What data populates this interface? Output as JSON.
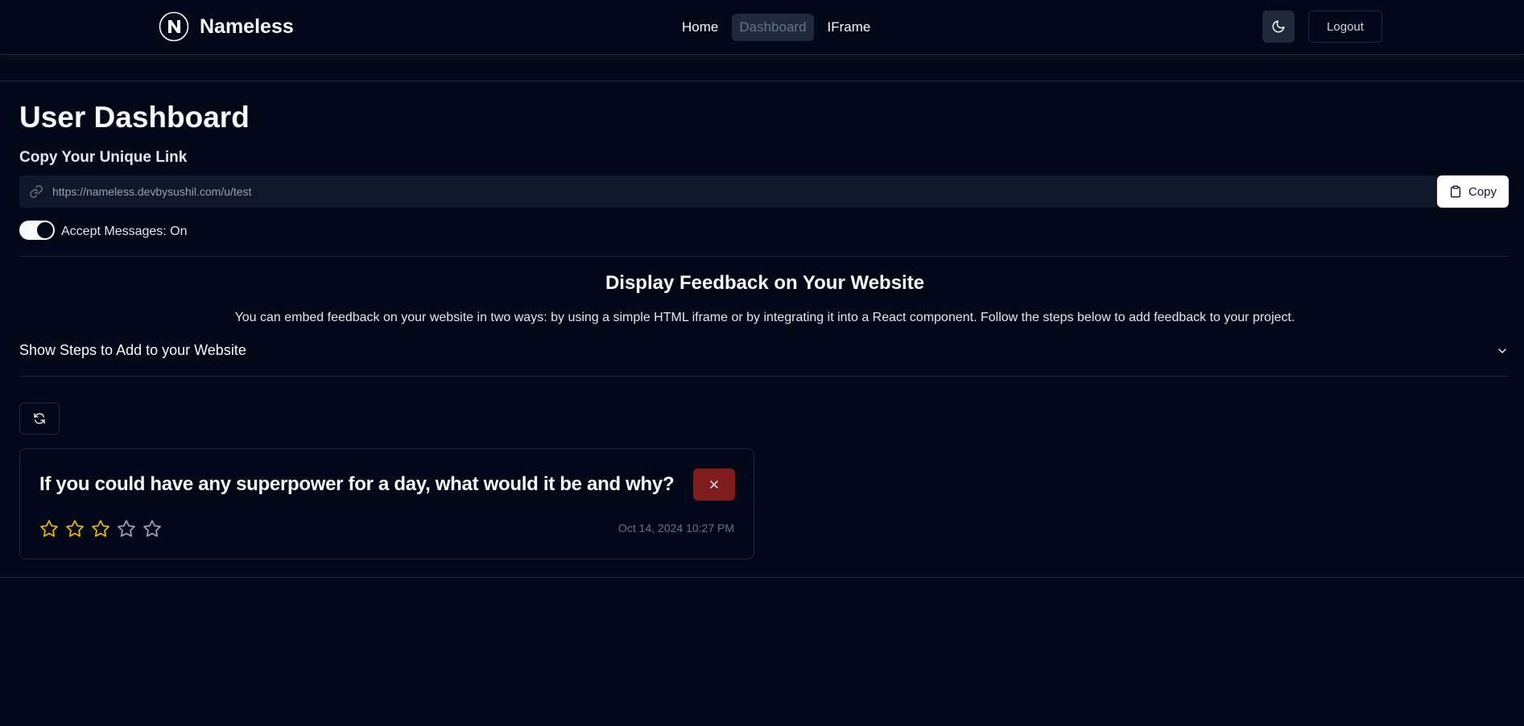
{
  "navbar": {
    "brand": "Nameless",
    "links": [
      {
        "label": "Home",
        "active": false
      },
      {
        "label": "Dashboard",
        "active": true
      },
      {
        "label": "IFrame",
        "active": false
      }
    ],
    "theme_icon": "moon-icon",
    "logout_label": "Logout"
  },
  "dashboard": {
    "title": "User Dashboard",
    "copy_heading": "Copy Your Unique Link",
    "unique_link": "https://nameless.devbysushil.com/u/test",
    "copy_label": "Copy",
    "accept_messages_label": "Accept Messages: On",
    "accept_messages": true
  },
  "embed": {
    "title": "Display Feedback on Your Website",
    "description": "You can embed feedback on your website in two ways: by using a simple HTML iframe or by integrating it into a React component. Follow the steps below to add feedback to your project.",
    "accordion_label": "Show Steps to Add to your Website"
  },
  "feedback": [
    {
      "question": "If you could have any superpower for a day, what would it be and why?",
      "rating": 3,
      "max_rating": 5,
      "timestamp": "Oct 14, 2024 10:27 PM"
    }
  ],
  "colors": {
    "background": "#020817",
    "star_filled": "#eab308",
    "star_empty": "#94a3b8",
    "delete": "#7f1d1d"
  }
}
